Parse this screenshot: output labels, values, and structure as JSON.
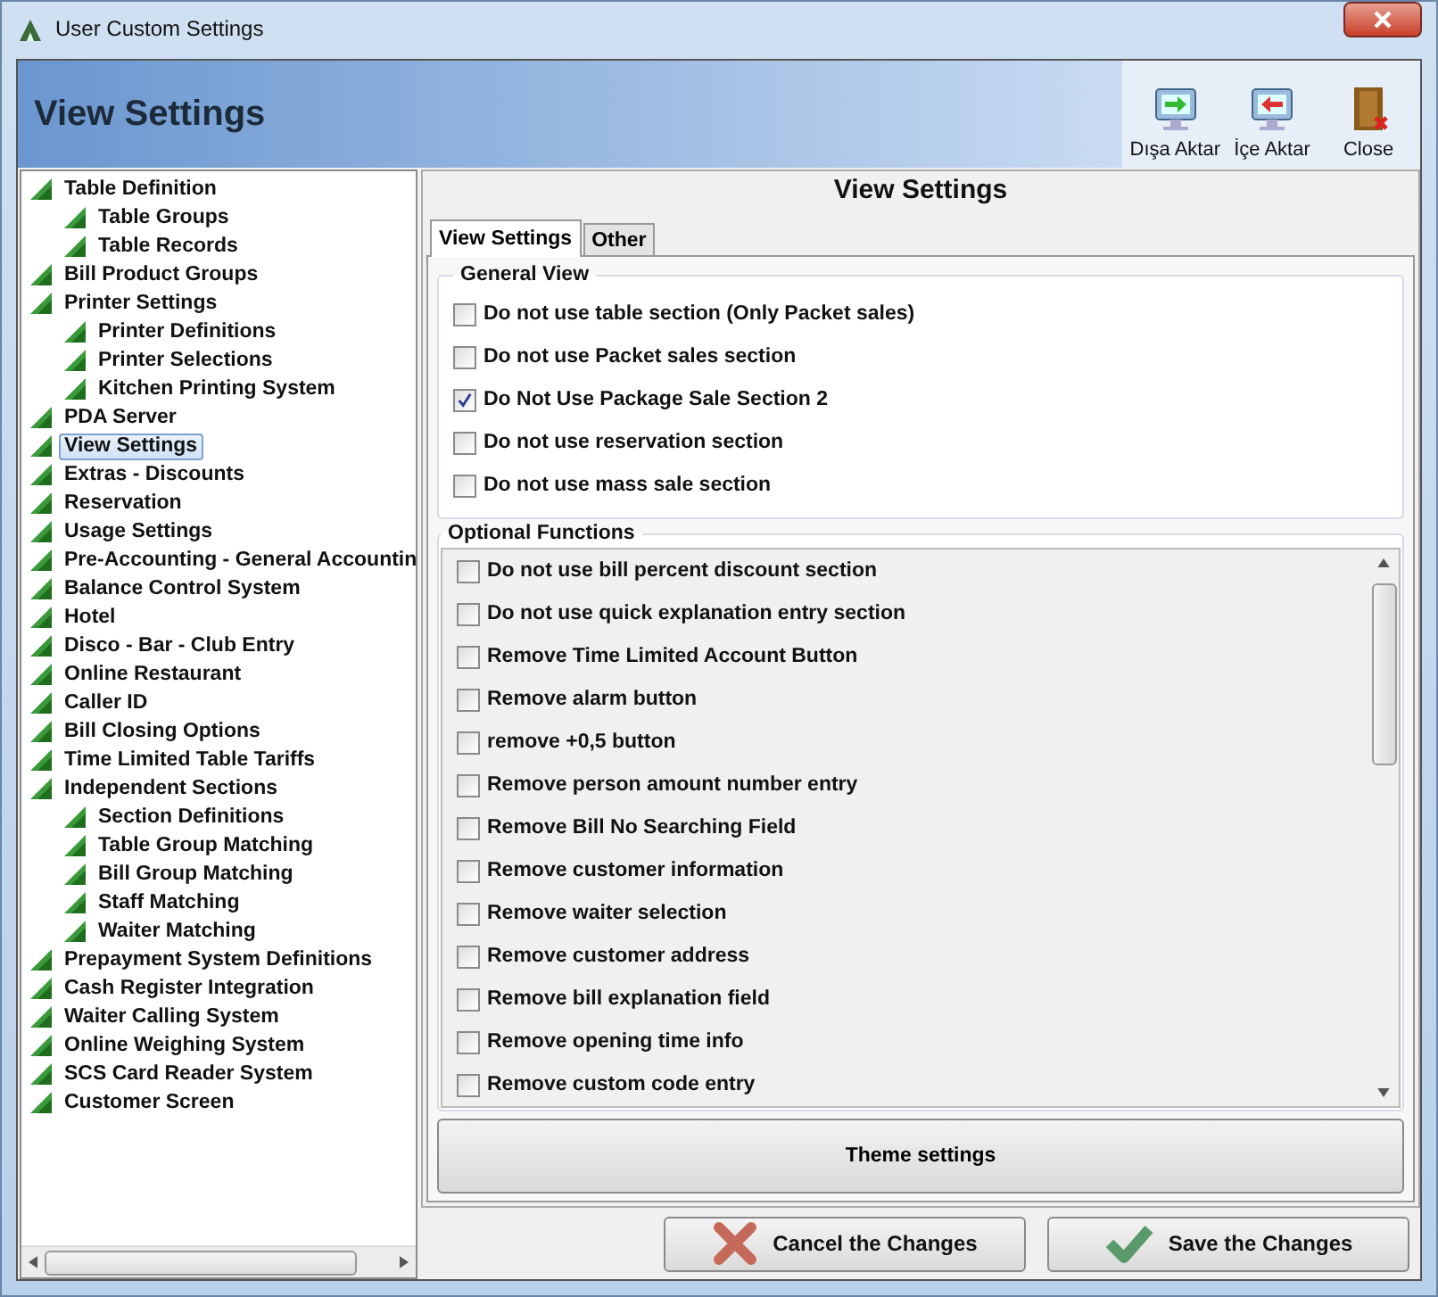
{
  "window": {
    "title": "User Custom Settings"
  },
  "header": {
    "title": "View Settings",
    "tools": [
      {
        "label": "Dışa Aktar",
        "kind": "export"
      },
      {
        "label": "İçe Aktar",
        "kind": "import"
      },
      {
        "label": "Close",
        "kind": "close"
      }
    ]
  },
  "tree": [
    {
      "label": "Table Definition",
      "selected": false,
      "children": [
        {
          "label": "Table Groups",
          "selected": false
        },
        {
          "label": "Table Records",
          "selected": false
        }
      ]
    },
    {
      "label": "Bill Product Groups",
      "selected": false
    },
    {
      "label": "Printer Settings",
      "selected": false,
      "children": [
        {
          "label": "Printer Definitions",
          "selected": false
        },
        {
          "label": "Printer Selections",
          "selected": false
        },
        {
          "label": "Kitchen Printing System",
          "selected": false
        }
      ]
    },
    {
      "label": "PDA Server",
      "selected": false
    },
    {
      "label": "View Settings",
      "selected": true
    },
    {
      "label": "Extras - Discounts",
      "selected": false
    },
    {
      "label": "Reservation",
      "selected": false
    },
    {
      "label": "Usage Settings",
      "selected": false
    },
    {
      "label": "Pre-Accounting - General Accountin",
      "selected": false
    },
    {
      "label": "Balance Control System",
      "selected": false
    },
    {
      "label": "Hotel",
      "selected": false
    },
    {
      "label": "Disco - Bar - Club Entry",
      "selected": false
    },
    {
      "label": "Online Restaurant",
      "selected": false
    },
    {
      "label": "Caller ID",
      "selected": false
    },
    {
      "label": "Bill Closing Options",
      "selected": false
    },
    {
      "label": "Time Limited Table Tariffs",
      "selected": false
    },
    {
      "label": "Independent Sections",
      "selected": false,
      "children": [
        {
          "label": "Section Definitions",
          "selected": false
        },
        {
          "label": "Table Group Matching",
          "selected": false
        },
        {
          "label": "Bill Group Matching",
          "selected": false
        },
        {
          "label": "Staff Matching",
          "selected": false
        },
        {
          "label": "Waiter Matching",
          "selected": false
        }
      ]
    },
    {
      "label": "Prepayment System Definitions",
      "selected": false
    },
    {
      "label": "Cash Register Integration",
      "selected": false
    },
    {
      "label": "Waiter Calling System",
      "selected": false
    },
    {
      "label": "Online Weighing System",
      "selected": false
    },
    {
      "label": "SCS Card Reader System",
      "selected": false
    },
    {
      "label": "Customer Screen",
      "selected": false
    }
  ],
  "panel": {
    "title": "View Settings",
    "tabs": [
      {
        "label": "View Settings",
        "selected": true
      },
      {
        "label": "Other",
        "selected": false
      }
    ],
    "general_view": {
      "title": "General View",
      "options": [
        {
          "label": "Do not use table section (Only Packet sales)",
          "checked": false
        },
        {
          "label": "Do not use Packet sales section",
          "checked": false
        },
        {
          "label": "Do Not Use Package Sale Section 2",
          "checked": true
        },
        {
          "label": "Do not use reservation section",
          "checked": false
        },
        {
          "label": "Do not use mass sale section",
          "checked": false
        }
      ]
    },
    "optional_functions": {
      "title": "Optional Functions",
      "options": [
        {
          "label": "Do not use bill percent discount section",
          "checked": false
        },
        {
          "label": "Do not use quick explanation entry section",
          "checked": false
        },
        {
          "label": "Remove Time Limited Account Button",
          "checked": false
        },
        {
          "label": "Remove alarm button",
          "checked": false
        },
        {
          "label": "remove +0,5 button",
          "checked": false
        },
        {
          "label": "Remove person amount number entry",
          "checked": false
        },
        {
          "label": "Remove Bill No Searching Field",
          "checked": false
        },
        {
          "label": "Remove customer information",
          "checked": false
        },
        {
          "label": "Remove waiter selection",
          "checked": false
        },
        {
          "label": "Remove customer address",
          "checked": false
        },
        {
          "label": "Remove bill explanation field",
          "checked": false
        },
        {
          "label": "Remove opening time info",
          "checked": false
        },
        {
          "label": "Remove custom code entry",
          "checked": false
        }
      ]
    },
    "theme_button": "Theme settings"
  },
  "footer": {
    "buttons": [
      {
        "label": "Cancel the Changes",
        "kind": "cancel"
      },
      {
        "label": "Save the Changes",
        "kind": "save"
      }
    ]
  }
}
